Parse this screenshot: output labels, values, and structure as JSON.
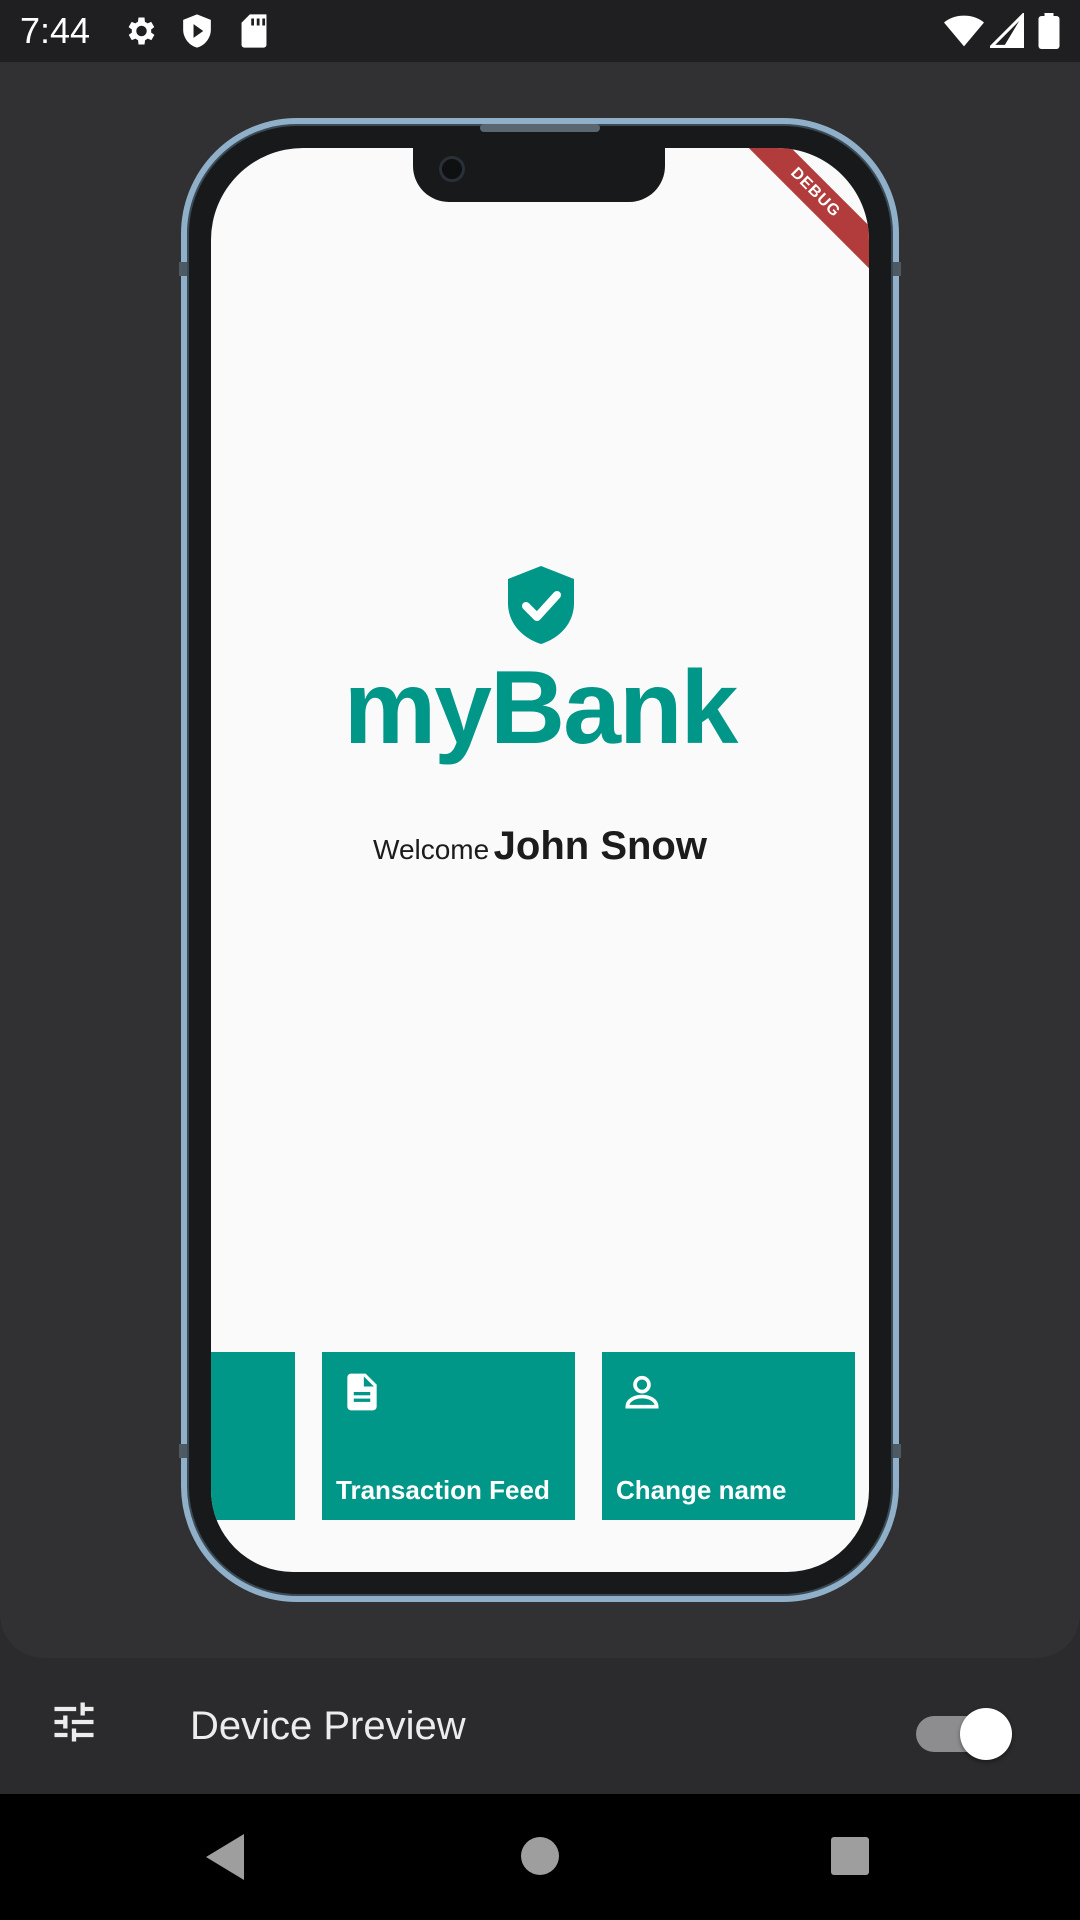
{
  "status_bar": {
    "time": "7:44",
    "icons": [
      "settings-icon",
      "play-protect-icon",
      "sd-card-icon",
      "wifi-icon",
      "signal-icon",
      "battery-icon"
    ]
  },
  "app": {
    "debug_banner": "DEBUG",
    "logo_icon": "shield-check-icon",
    "title": "myBank",
    "welcome_label": "Welcome",
    "user_name": "John Snow",
    "tiles": [
      {
        "label": "",
        "icon": ""
      },
      {
        "label": "Transaction Feed",
        "icon": "document-icon"
      },
      {
        "label": "Change name",
        "icon": "person-icon"
      }
    ]
  },
  "toolbar": {
    "settings_icon": "tune-icon",
    "title": "Device Preview",
    "toggle_on": true
  },
  "nav_bar": {
    "buttons": [
      "back-icon",
      "home-icon",
      "recents-icon"
    ]
  },
  "colors": {
    "accent": "#009688",
    "debug": "#b23b3b",
    "frame": "#8fb0c8"
  }
}
